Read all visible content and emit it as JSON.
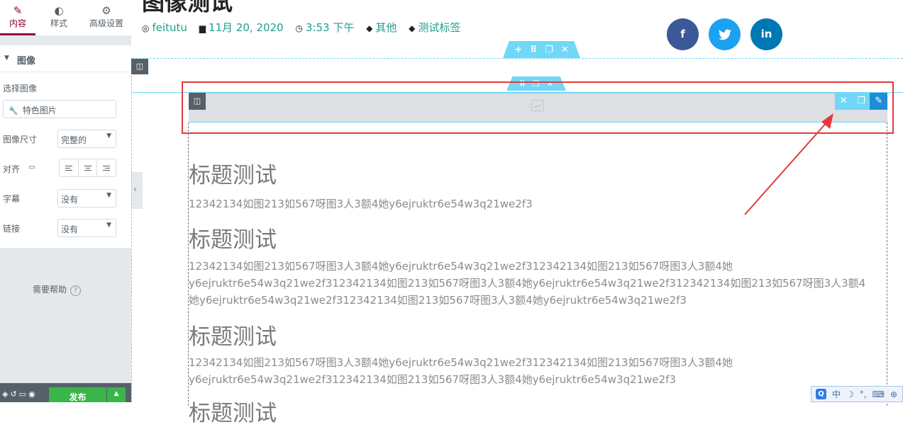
{
  "panel": {
    "tabs": [
      {
        "label": "内容",
        "icon": "pencil-icon"
      },
      {
        "label": "样式",
        "icon": "half-circle-icon"
      },
      {
        "label": "高级设置",
        "icon": "gear-icon"
      }
    ],
    "section_title": "图像",
    "select_image_label": "选择图像",
    "image_field_value": "特色图片",
    "size_label": "图像尺寸",
    "size_value": "完整的",
    "align_label": "对齐",
    "caption_label": "字幕",
    "caption_value": "没有",
    "link_label": "链接",
    "link_value": "没有",
    "help_label": "需要帮助",
    "publish_label": "发布",
    "accent_color": "#93003c",
    "publish_color": "#39b54a"
  },
  "post": {
    "title": "图像测试",
    "author": "feitutu",
    "date": "11月 20, 2020",
    "time": "3:53 下午",
    "category": "其他",
    "tag": "测试标签"
  },
  "share": [
    {
      "network": "facebook",
      "icon": "facebook-icon",
      "color": "#3b5998"
    },
    {
      "network": "twitter",
      "icon": "twitter-icon",
      "color": "#1da1f2"
    },
    {
      "network": "linkedin",
      "icon": "linkedin-icon",
      "color": "#0077b5"
    }
  ],
  "content": {
    "h1": "标题测试",
    "p1": "12342134如图213如567呀图3人3额4她y6ejruktr6e54w3q21we2f3",
    "h2": "标题测试",
    "p2": "12342134如图213如567呀图3人3额4她y6ejruktr6e54w3q21we2f312342134如图213如567呀图3人3额4她y6ejruktr6e54w3q21we2f312342134如图213如567呀图3人3额4她y6ejruktr6e54w3q21we2f312342134如图213如567呀图3人3额4她y6ejruktr6e54w3q21we2f312342134如图213如567呀图3人3额4她y6ejruktr6e54w3q21we2f3",
    "h3": "标题测试",
    "p3": "12342134如图213如567呀图3人3额4她y6ejruktr6e54w3q21we2f312342134如图213如567呀图3人3额4她y6ejruktr6e54w3q21we2f312342134如图213如567呀图3人3额4她y6ejruktr6e54w3q21we2f3",
    "h4": "标题测试"
  },
  "ime": {
    "lang": "中"
  },
  "editor_accent": "#71d7f7",
  "annotation_color": "#e4393c"
}
